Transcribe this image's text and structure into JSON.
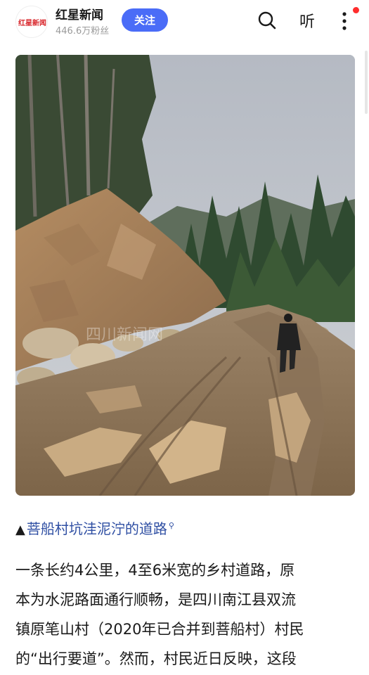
{
  "header": {
    "avatar_text": "红星新闻",
    "account_name": "红星新闻",
    "fans": "446.6万粉丝",
    "follow_label": "关注",
    "listen_label": "听"
  },
  "photo": {
    "watermark_text": "四川新闻网",
    "description": ""
  },
  "caption": {
    "prefix_icon": "▲",
    "text": "菩船村坑洼泥泞的道路",
    "search_hint": "⚲"
  },
  "article": {
    "lines": [
      "一条长约4公里，4至6米宽的乡村道路，原",
      "本为水泥路面通行顺畅，是四川南江县双流",
      "镇原笔山村（2020年已合并到菩船村）村民",
      "的“出行要道”。然而，村民近日反映，这段"
    ]
  },
  "colors": {
    "accent": "#4a6cf7",
    "caption": "#2f4fa3",
    "notify": "#ff2d2d"
  },
  "icons": [
    "search-icon",
    "more-vertical-icon",
    "notification-dot-icon"
  ]
}
